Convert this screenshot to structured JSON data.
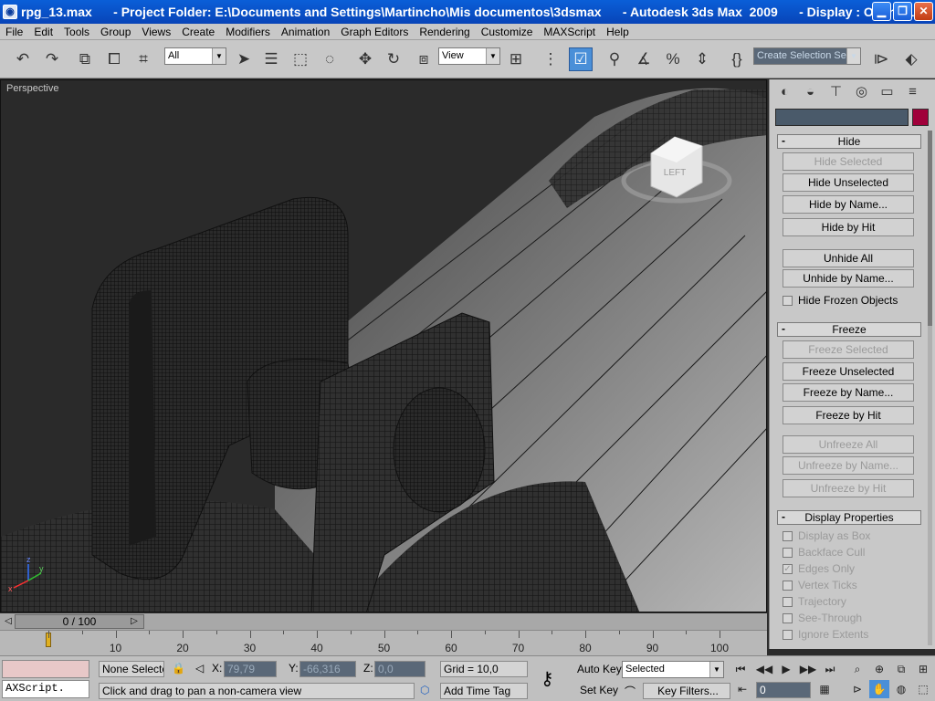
{
  "window": {
    "title": "rpg_13.max      - Project Folder: E:\\Documents and Settings\\Martincho\\Mis documentos\\3dsmax      - Autodesk 3ds Max  2009      - Display : OpenGL"
  },
  "menu": [
    "File",
    "Edit",
    "Tools",
    "Group",
    "Views",
    "Create",
    "Modifiers",
    "Animation",
    "Graph Editors",
    "Rendering",
    "Customize",
    "MAXScript",
    "Help"
  ],
  "toolbar": {
    "selection_filter": "All",
    "reference_coord": "View",
    "named_selection_placeholder": "Create Selection Se"
  },
  "viewport": {
    "label": "Perspective",
    "viewcube_label": "LEFT",
    "axis_x": "x",
    "axis_y": "y",
    "axis_z": "z"
  },
  "command_panel": {
    "hide_rollout": {
      "title": "Hide",
      "buttons": [
        "Hide Selected",
        "Hide Unselected",
        "Hide by Name...",
        "Hide by Hit",
        "Unhide All",
        "Unhide by Name..."
      ],
      "checkbox": "Hide Frozen Objects"
    },
    "freeze_rollout": {
      "title": "Freeze",
      "buttons": [
        "Freeze Selected",
        "Freeze Unselected",
        "Freeze by Name...",
        "Freeze by Hit",
        "Unfreeze All",
        "Unfreeze by Name...",
        "Unfreeze by Hit"
      ]
    },
    "display_rollout": {
      "title": "Display Properties",
      "checkboxes": [
        "Display as Box",
        "Backface Cull",
        "Edges Only",
        "Vertex Ticks",
        "Trajectory",
        "See-Through",
        "Ignore Extents"
      ]
    }
  },
  "timeline": {
    "frame_display": "0 / 100",
    "ticks": [
      "10",
      "20",
      "30",
      "40",
      "50",
      "60",
      "70",
      "80",
      "90",
      "100"
    ]
  },
  "status": {
    "selection": "None Selecte",
    "x_label": "X:",
    "x_value": "79,79",
    "y_label": "Y:",
    "y_value": "-66,316",
    "z_label": "Z:",
    "z_value": "0,0",
    "grid": "Grid = 10,0",
    "prompt": "Click and drag to pan a non-camera view",
    "add_time_tag": "Add Time Tag",
    "maxscript": "AXScript.",
    "auto_key": "Auto Key",
    "set_key": "Set Key",
    "key_mode": "Selected",
    "key_filters": "Key Filters...",
    "current_frame": "0"
  }
}
